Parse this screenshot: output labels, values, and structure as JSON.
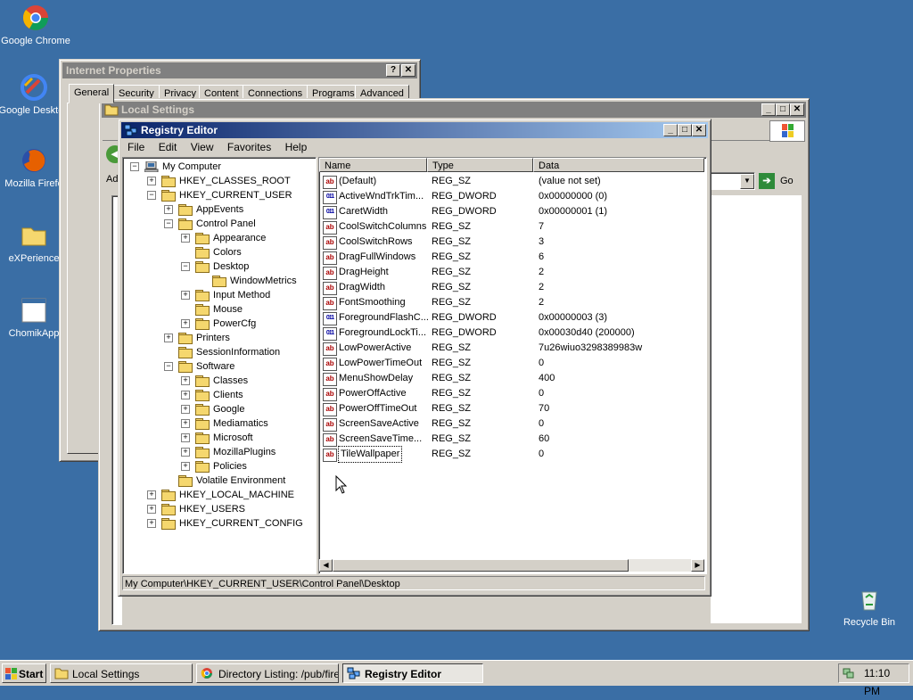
{
  "desktop": {
    "icons": [
      {
        "label": "Google Chrome",
        "icon": "chrome-icon"
      },
      {
        "label": "Google Desktop",
        "icon": "google-desktop-icon"
      },
      {
        "label": "Mozilla Firefo",
        "icon": "firefox-icon"
      },
      {
        "label": "eXPerience",
        "icon": "folder-icon"
      },
      {
        "label": "ChomikApp",
        "icon": "chomikapp-icon"
      },
      {
        "label": "Recycle Bin",
        "icon": "recycle-bin-icon"
      }
    ]
  },
  "internet_properties": {
    "title": "Internet Properties",
    "help": "?",
    "close": "✕",
    "tabs": [
      "General",
      "Security",
      "Privacy",
      "Content",
      "Connections",
      "Programs",
      "Advanced"
    ]
  },
  "local_settings": {
    "title": "Local Settings",
    "addr_label": "Ad",
    "go_label": "Go"
  },
  "registry": {
    "title": "Registry Editor",
    "menu": [
      "File",
      "Edit",
      "View",
      "Favorites",
      "Help"
    ],
    "tree": [
      {
        "label": "My Computer",
        "depth": 0,
        "exp": "-",
        "icon": "computer"
      },
      {
        "label": "HKEY_CLASSES_ROOT",
        "depth": 1,
        "exp": "+"
      },
      {
        "label": "HKEY_CURRENT_USER",
        "depth": 1,
        "exp": "-"
      },
      {
        "label": "AppEvents",
        "depth": 2,
        "exp": "+"
      },
      {
        "label": "Control Panel",
        "depth": 2,
        "exp": "-"
      },
      {
        "label": "Appearance",
        "depth": 3,
        "exp": "+"
      },
      {
        "label": "Colors",
        "depth": 3,
        "exp": ""
      },
      {
        "label": "Desktop",
        "depth": 3,
        "exp": "-",
        "open": true
      },
      {
        "label": "WindowMetrics",
        "depth": 4,
        "exp": ""
      },
      {
        "label": "Input Method",
        "depth": 3,
        "exp": "+"
      },
      {
        "label": "Mouse",
        "depth": 3,
        "exp": ""
      },
      {
        "label": "PowerCfg",
        "depth": 3,
        "exp": "+"
      },
      {
        "label": "Printers",
        "depth": 2,
        "exp": "+"
      },
      {
        "label": "SessionInformation",
        "depth": 2,
        "exp": ""
      },
      {
        "label": "Software",
        "depth": 2,
        "exp": "-"
      },
      {
        "label": "Classes",
        "depth": 3,
        "exp": "+"
      },
      {
        "label": "Clients",
        "depth": 3,
        "exp": "+"
      },
      {
        "label": "Google",
        "depth": 3,
        "exp": "+"
      },
      {
        "label": "Mediamatics",
        "depth": 3,
        "exp": "+"
      },
      {
        "label": "Microsoft",
        "depth": 3,
        "exp": "+"
      },
      {
        "label": "MozillaPlugins",
        "depth": 3,
        "exp": "+"
      },
      {
        "label": "Policies",
        "depth": 3,
        "exp": "+"
      },
      {
        "label": "Volatile Environment",
        "depth": 2,
        "exp": ""
      },
      {
        "label": "HKEY_LOCAL_MACHINE",
        "depth": 1,
        "exp": "+"
      },
      {
        "label": "HKEY_USERS",
        "depth": 1,
        "exp": "+"
      },
      {
        "label": "HKEY_CURRENT_CONFIG",
        "depth": 1,
        "exp": "+"
      }
    ],
    "columns": [
      "Name",
      "Type",
      "Data"
    ],
    "values": [
      {
        "name": "(Default)",
        "type": "REG_SZ",
        "data": "(value not set)"
      },
      {
        "name": "ActiveWndTrkTim...",
        "type": "REG_DWORD",
        "data": "0x00000000 (0)"
      },
      {
        "name": "CaretWidth",
        "type": "REG_DWORD",
        "data": "0x00000001 (1)"
      },
      {
        "name": "CoolSwitchColumns",
        "type": "REG_SZ",
        "data": "7"
      },
      {
        "name": "CoolSwitchRows",
        "type": "REG_SZ",
        "data": "3"
      },
      {
        "name": "DragFullWindows",
        "type": "REG_SZ",
        "data": "6"
      },
      {
        "name": "DragHeight",
        "type": "REG_SZ",
        "data": "2"
      },
      {
        "name": "DragWidth",
        "type": "REG_SZ",
        "data": "2"
      },
      {
        "name": "FontSmoothing",
        "type": "REG_SZ",
        "data": "2"
      },
      {
        "name": "ForegroundFlashC...",
        "type": "REG_DWORD",
        "data": "0x00000003 (3)"
      },
      {
        "name": "ForegroundLockTi...",
        "type": "REG_DWORD",
        "data": "0x00030d40 (200000)"
      },
      {
        "name": "LowPowerActive",
        "type": "REG_SZ",
        "data": "7u26wiuo3298389983w"
      },
      {
        "name": "LowPowerTimeOut",
        "type": "REG_SZ",
        "data": "0"
      },
      {
        "name": "MenuShowDelay",
        "type": "REG_SZ",
        "data": "400"
      },
      {
        "name": "PowerOffActive",
        "type": "REG_SZ",
        "data": "0"
      },
      {
        "name": "PowerOffTimeOut",
        "type": "REG_SZ",
        "data": "70"
      },
      {
        "name": "ScreenSaveActive",
        "type": "REG_SZ",
        "data": "0"
      },
      {
        "name": "ScreenSaveTime...",
        "type": "REG_SZ",
        "data": "60"
      },
      {
        "name": "TileWallpaper",
        "type": "REG_SZ",
        "data": "0"
      }
    ],
    "icon_text": {
      "sz": "ab",
      "dword": "011"
    },
    "status": "My Computer\\HKEY_CURRENT_USER\\Control Panel\\Desktop"
  },
  "taskbar": {
    "start": "Start",
    "items": [
      {
        "label": "Local Settings",
        "icon": "folder-icon"
      },
      {
        "label": "Directory Listing: /pub/fire...",
        "icon": "chrome-icon"
      },
      {
        "label": "Registry Editor",
        "icon": "regedit-icon"
      }
    ],
    "clock": "11:10 PM"
  },
  "colors": {
    "desktop": "#3a6ea5",
    "title_active": "#0a246a",
    "title_inactive": "#808080"
  }
}
